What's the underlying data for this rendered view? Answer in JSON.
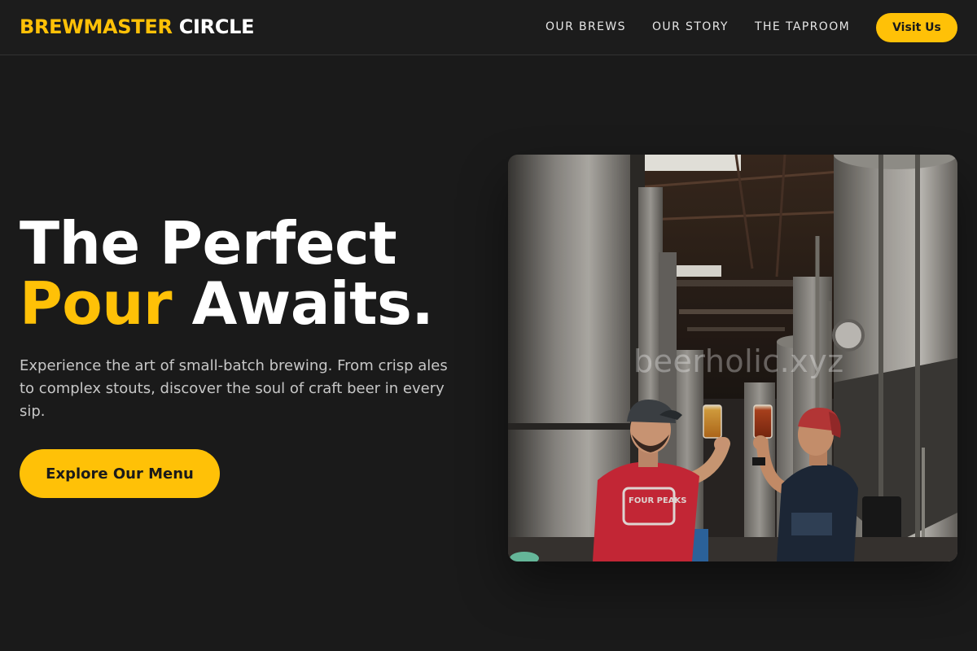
{
  "brand": {
    "accent_word": "BREWMASTER",
    "main_word": "CIRCLE"
  },
  "nav": {
    "links": [
      {
        "label": "OUR BREWS"
      },
      {
        "label": "OUR STORY"
      },
      {
        "label": "THE TAPROOM"
      }
    ],
    "cta_label": "Visit Us"
  },
  "hero": {
    "title_line1": "The Perfect",
    "title_accent": "Pour",
    "title_rest": "Awaits.",
    "subtitle": "Experience the art of small-batch brewing. From crisp ales to complex stouts, discover the soul of craft beer in every sip.",
    "cta_label": "Explore Our Menu",
    "image_watermark": "beerholic.xyz"
  },
  "colors": {
    "background": "#1a1a1a",
    "accent": "#ffc107",
    "text_primary": "#ffffff",
    "text_secondary": "#c7c7c7"
  }
}
